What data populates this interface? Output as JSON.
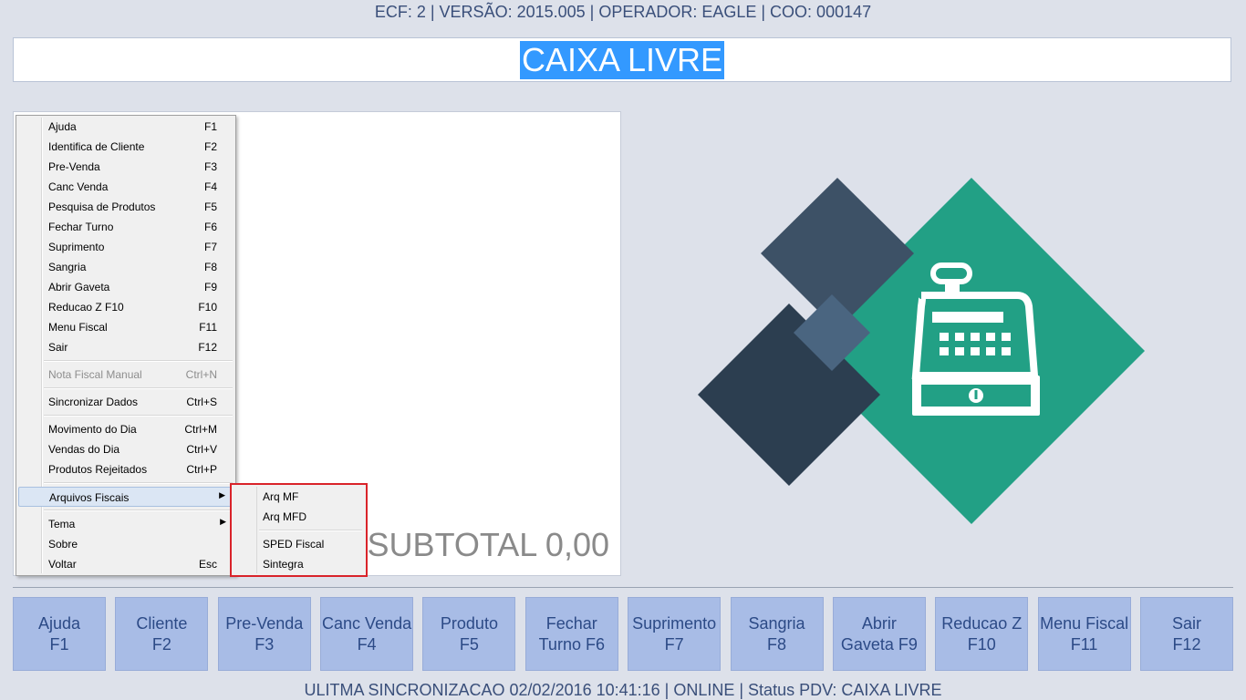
{
  "header": {
    "info": "ECF: 2 | VERSÃO: 2015.005 | OPERADOR: EAGLE | COO: 000147"
  },
  "status": {
    "text": "CAIXA LIVRE",
    "highlight_color": "#3399ff"
  },
  "sale_panel": {
    "subtotal": "SUBTOTAL 0,00"
  },
  "menu": {
    "items": [
      {
        "label": "Ajuda",
        "shortcut": "F1"
      },
      {
        "label": "Identifica de Cliente",
        "shortcut": "F2"
      },
      {
        "label": "Pre-Venda",
        "shortcut": "F3"
      },
      {
        "label": "Canc Venda",
        "shortcut": "F4"
      },
      {
        "label": "Pesquisa de Produtos",
        "shortcut": "F5"
      },
      {
        "label": "Fechar Turno",
        "shortcut": "F6"
      },
      {
        "label": "Suprimento",
        "shortcut": "F7"
      },
      {
        "label": "Sangria",
        "shortcut": "F8"
      },
      {
        "label": "Abrir Gaveta",
        "shortcut": "F9"
      },
      {
        "label": "Reducao Z F10",
        "shortcut": "F10"
      },
      {
        "label": "Menu Fiscal",
        "shortcut": "F11"
      },
      {
        "label": "Sair",
        "shortcut": "F12"
      },
      {
        "label": "Nota Fiscal Manual",
        "shortcut": "Ctrl+N"
      },
      {
        "label": "Sincronizar Dados",
        "shortcut": "Ctrl+S"
      },
      {
        "label": "Movimento do Dia",
        "shortcut": "Ctrl+M"
      },
      {
        "label": "Vendas do Dia",
        "shortcut": "Ctrl+V"
      },
      {
        "label": "Produtos Rejeitados",
        "shortcut": "Ctrl+P"
      },
      {
        "label": "Arquivos Fiscais",
        "shortcut": ""
      },
      {
        "label": "Tema",
        "shortcut": ""
      },
      {
        "label": "Sobre",
        "shortcut": ""
      },
      {
        "label": "Voltar",
        "shortcut": "Esc"
      }
    ],
    "submenu": [
      {
        "label": "Arq MF"
      },
      {
        "label": "Arq MFD"
      },
      {
        "label": "SPED Fiscal"
      },
      {
        "label": "Sintegra"
      }
    ]
  },
  "logo": {
    "colors": {
      "green": "#22a085",
      "dark": "#2c3e50",
      "mid": "#3d5166",
      "small": "#4a6580"
    },
    "icon": "cash-register-icon"
  },
  "fkeys": [
    {
      "line1": "Ajuda",
      "line2": "F1"
    },
    {
      "line1": "Cliente",
      "line2": "F2"
    },
    {
      "line1": "Pre-Venda",
      "line2": "F3"
    },
    {
      "line1": "Canc Venda",
      "line2": "F4"
    },
    {
      "line1": "Produto",
      "line2": "F5"
    },
    {
      "line1": "Fechar",
      "line2": "Turno F6"
    },
    {
      "line1": "Suprimento",
      "line2": "F7"
    },
    {
      "line1": "Sangria",
      "line2": "F8"
    },
    {
      "line1": "Abrir",
      "line2": "Gaveta F9"
    },
    {
      "line1": "Reducao Z",
      "line2": "F10"
    },
    {
      "line1": "Menu Fiscal",
      "line2": "F11"
    },
    {
      "line1": "Sair",
      "line2": "F12"
    }
  ],
  "footer": {
    "text": "ULITMA SINCRONIZACAO 02/02/2016 10:41:16 | ONLINE | Status PDV: CAIXA LIVRE"
  }
}
